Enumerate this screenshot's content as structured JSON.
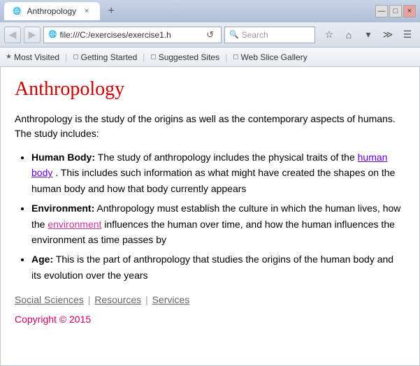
{
  "browser": {
    "tab_title": "Anthropology",
    "tab_close": "×",
    "tab_new": "+",
    "title_controls": [
      "—",
      "□",
      "×"
    ],
    "address": "file:///C:/exercises/exercise1.h",
    "search_placeholder": "Search",
    "nav_back": "◀",
    "nav_forward": "▶",
    "nav_refresh": "↺",
    "bookmarks": [
      {
        "icon": "★",
        "label": "Most Visited"
      },
      {
        "icon": "◻",
        "label": "Getting Started"
      },
      {
        "icon": "◻",
        "label": "Suggested Sites"
      },
      {
        "icon": "◻",
        "label": "Web Slice Gallery"
      }
    ]
  },
  "page": {
    "title": "Anthropology",
    "intro": "Anthropology is the study of the origins as well as the contemporary aspects of humans. The study includes:",
    "items": [
      {
        "heading": "Human Body:",
        "text1": " The study of anthropology includes the physical traits of the ",
        "link1_text": "human body",
        "text2": ". This includes such information as what might have created the shapes on the human body and how that body currently appears"
      },
      {
        "heading": "Environment:",
        "text1": " Anthropology must establish the culture in which the human lives, how the ",
        "link1_text": "environment",
        "text2": " influences the human over time, and how the human influences the environment as time passes by"
      },
      {
        "heading": "Age:",
        "text1": " This is the part of anthropology that studies the origins of the human body and its evolution over the years",
        "link1_text": "",
        "text2": ""
      }
    ],
    "footer_links": [
      {
        "label": "Social Sciences"
      },
      {
        "label": "Resources"
      },
      {
        "label": "Services"
      }
    ],
    "copyright": "Copyright © 2015"
  }
}
